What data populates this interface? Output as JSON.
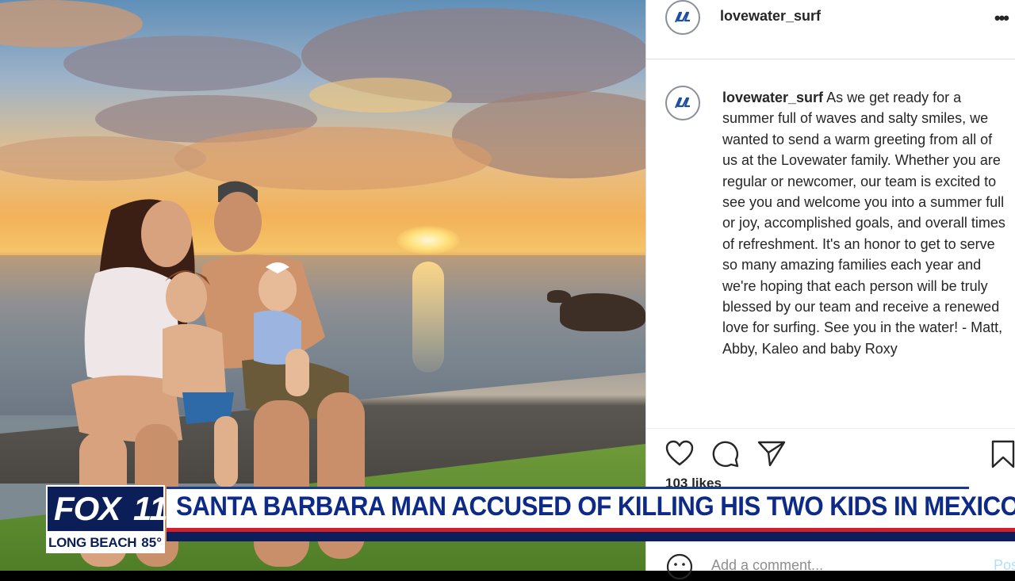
{
  "post": {
    "header_username": "lovewater_surf",
    "caption_username": "lovewater_surf",
    "caption_text": "As we get ready for a summer full of waves and salty smiles, we wanted to send a warm greeting from all of us at the Lovewater family. Whether you are regular or newcomer, our team is excited to see you and welcome you into a summer full or joy, accomplished goals, and overall times of refreshment. It's an honor to get to serve so many amazing families each year and we're hoping that each person will be truly blessed by our team and receive a renewed love for surfing. See you in the water! - Matt, Abby, Kaleo and baby Roxy",
    "likes_partial": "103 likes",
    "comment_placeholder": "Add a comment...",
    "post_label": "Post"
  },
  "broadcast": {
    "headline": "SANTA BARBARA MAN ACCUSED OF KILLING HIS TWO KIDS IN MEXICO",
    "station": "FOX",
    "channel": "11",
    "location": "LONG BEACH",
    "temperature": "85°"
  },
  "colors": {
    "fox_blue": "#0c1e57",
    "headline_blue": "#0d2a86",
    "accent_red": "#d21f2b"
  },
  "icons": [
    "lovewater-logo-icon",
    "more-options-icon",
    "heart-icon",
    "comment-icon",
    "share-icon",
    "bookmark-icon",
    "emoji-icon"
  ]
}
